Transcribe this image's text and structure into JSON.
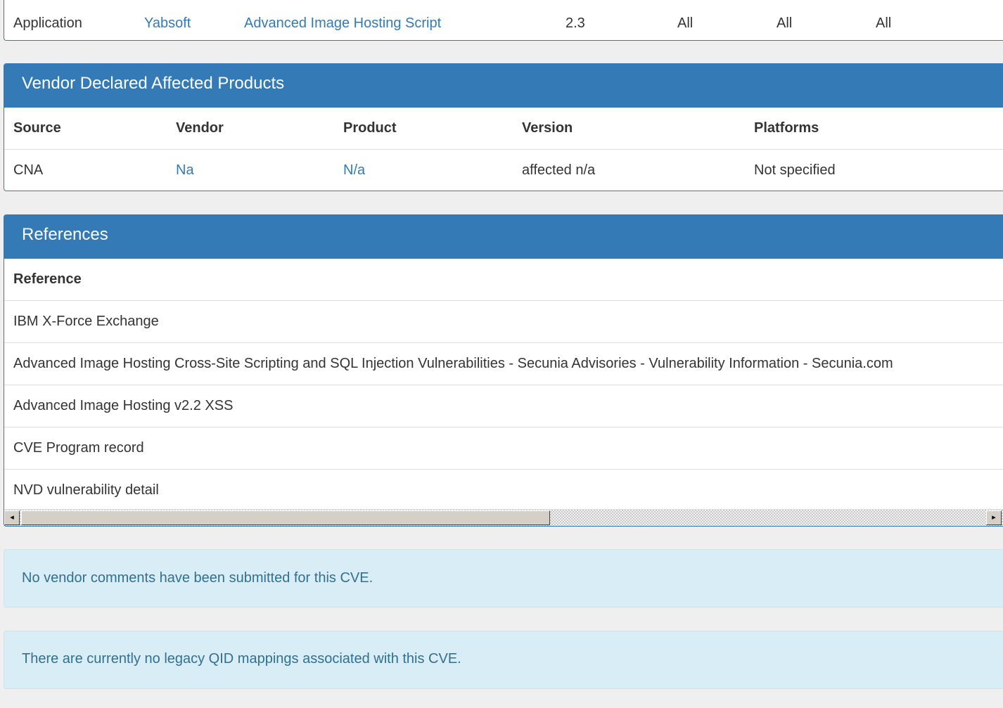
{
  "affected_products_row": {
    "type": "Application",
    "vendor": "Yabsoft",
    "product": "Advanced Image Hosting Script",
    "version": "2.3",
    "col5": "All",
    "col6": "All",
    "col7": "All"
  },
  "vendor_declared": {
    "title": "Vendor Declared Affected Products",
    "headers": [
      "Source",
      "Vendor",
      "Product",
      "Version",
      "Platforms"
    ],
    "rows": [
      {
        "source": "CNA",
        "vendor": "Na",
        "product": "N/a",
        "version": "affected n/a",
        "platforms": "Not specified"
      }
    ]
  },
  "references": {
    "title": "References",
    "header": "Reference",
    "items": [
      "IBM X-Force Exchange",
      "Advanced Image Hosting Cross-Site Scripting and SQL Injection Vulnerabilities - Secunia Advisories - Vulnerability Information - Secunia.com",
      "Advanced Image Hosting v2.2 XSS",
      "CVE Program record",
      "NVD vulnerability detail"
    ],
    "scrollbar": {
      "left_arrow": "◂",
      "right_arrow": "▸"
    }
  },
  "alerts": {
    "vendor_comments": "No vendor comments have been submitted for this CVE.",
    "qid_mappings": "There are currently no legacy QID mappings associated with this CVE."
  },
  "colors": {
    "panel_heading": "#337ab7",
    "link": "#337ab7",
    "alert_bg": "#d9edf7",
    "alert_text": "#31708f"
  }
}
